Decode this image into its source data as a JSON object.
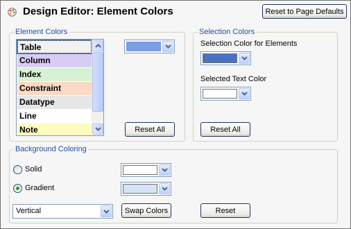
{
  "header": {
    "title": "Design Editor: Element Colors",
    "icon": "palette-icon",
    "reset_defaults_label": "Reset to Page Defaults"
  },
  "element_colors": {
    "title": "Element Colors",
    "items": [
      {
        "label": "Table",
        "color": "#f1f1f1",
        "selected": true
      },
      {
        "label": "Column",
        "color": "#d9ccf3",
        "selected": false
      },
      {
        "label": "Index",
        "color": "#d7f1d4",
        "selected": false
      },
      {
        "label": "Constraint",
        "color": "#fcd9c4",
        "selected": false
      },
      {
        "label": "Datatype",
        "color": "#e6e6e6",
        "selected": false
      },
      {
        "label": "Line",
        "color": "#ffffff",
        "selected": false
      },
      {
        "label": "Note",
        "color": "#fdfcc0",
        "selected": false
      }
    ],
    "selected_color": "#7b9ee0",
    "reset_all_label": "Reset All"
  },
  "selection_colors": {
    "title": "Selection Colors",
    "element_label": "Selection Color for Elements",
    "element_color": "#4a72c4",
    "text_label": "Selected Text Color",
    "text_color": "#ffffff",
    "reset_all_label": "Reset All"
  },
  "background": {
    "title": "Background Coloring",
    "solid_label": "Solid",
    "gradient_label": "Gradient",
    "mode": "gradient",
    "solid_color": "#ffffff",
    "gradient_color": "#d7e3f6",
    "direction": "Vertical",
    "swap_label": "Swap Colors",
    "reset_label": "Reset"
  }
}
